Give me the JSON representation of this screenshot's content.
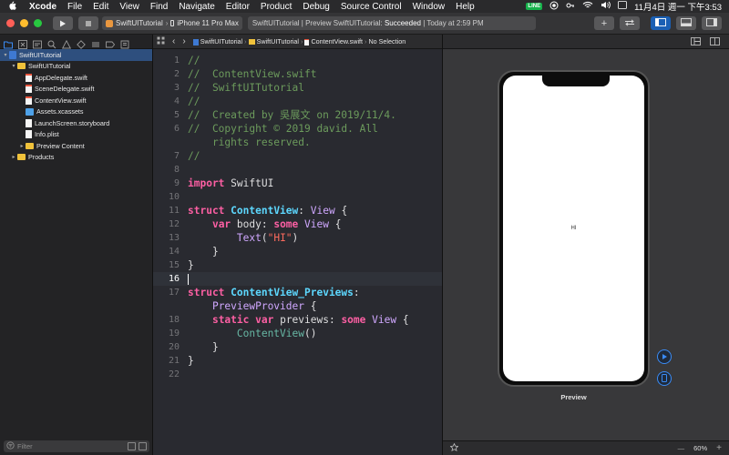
{
  "menubar": {
    "app": "Xcode",
    "items": [
      "File",
      "Edit",
      "View",
      "Find",
      "Navigate",
      "Editor",
      "Product",
      "Debug",
      "Source Control",
      "Window",
      "Help"
    ],
    "line_badge": "LINE",
    "datetime": "11月4日 週一 下午3:53"
  },
  "toolbar": {
    "scheme": "SwiftUITutorial",
    "device": "iPhone 11 Pro Max",
    "activity_prefix": "SwiftUITutorial | Preview SwiftUITutorial:",
    "activity_status": "Succeeded",
    "activity_time": "| Today at 2:59 PM"
  },
  "navigator": {
    "tree": [
      {
        "label": "SwiftUITutorial",
        "indent": 0,
        "icon": "project",
        "disclosure": "▾",
        "selected": true
      },
      {
        "label": "SwiftUITutorial",
        "indent": 1,
        "icon": "folder",
        "disclosure": "▾"
      },
      {
        "label": "AppDelegate.swift",
        "indent": 2,
        "icon": "swift"
      },
      {
        "label": "SceneDelegate.swift",
        "indent": 2,
        "icon": "swift"
      },
      {
        "label": "ContentView.swift",
        "indent": 2,
        "icon": "swift"
      },
      {
        "label": "Assets.xcassets",
        "indent": 2,
        "icon": "assets"
      },
      {
        "label": "LaunchScreen.storyboard",
        "indent": 2,
        "icon": "plain"
      },
      {
        "label": "Info.plist",
        "indent": 2,
        "icon": "plain"
      },
      {
        "label": "Preview Content",
        "indent": 2,
        "icon": "folder",
        "disclosure": "▸"
      },
      {
        "label": "Products",
        "indent": 1,
        "icon": "folder",
        "disclosure": "▸"
      }
    ],
    "filter_placeholder": "Filter"
  },
  "jumpbar": {
    "crumbs": [
      "SwiftUITutorial",
      "SwiftUITutorial",
      "ContentView.swift",
      "No Selection"
    ]
  },
  "editor": {
    "current_line": 16,
    "lines": [
      {
        "n": "1",
        "tokens": [
          [
            "comment",
            "//"
          ]
        ]
      },
      {
        "n": "2",
        "tokens": [
          [
            "comment",
            "//  ContentView.swift"
          ]
        ]
      },
      {
        "n": "3",
        "tokens": [
          [
            "comment",
            "//  SwiftUITutorial"
          ]
        ]
      },
      {
        "n": "4",
        "tokens": [
          [
            "comment",
            "//"
          ]
        ]
      },
      {
        "n": "5",
        "tokens": [
          [
            "comment",
            "//  Created by 吳展文 on 2019/11/4."
          ]
        ]
      },
      {
        "n": "6",
        "tokens": [
          [
            "comment",
            "//  Copyright © 2019 david. All"
          ]
        ]
      },
      {
        "n": "",
        "tokens": [
          [
            "comment",
            "    rights reserved."
          ]
        ]
      },
      {
        "n": "7",
        "tokens": [
          [
            "comment",
            "//"
          ]
        ]
      },
      {
        "n": "8",
        "tokens": []
      },
      {
        "n": "9",
        "tokens": [
          [
            "keyword",
            "import"
          ],
          [
            "plain",
            " SwiftUI"
          ]
        ]
      },
      {
        "n": "10",
        "tokens": []
      },
      {
        "n": "11",
        "tokens": [
          [
            "keyword",
            "struct"
          ],
          [
            "plain",
            " "
          ],
          [
            "type",
            "ContentView"
          ],
          [
            "plain",
            ": "
          ],
          [
            "sys",
            "View"
          ],
          [
            "plain",
            " {"
          ]
        ]
      },
      {
        "n": "12",
        "tokens": [
          [
            "plain",
            "    "
          ],
          [
            "keyword",
            "var"
          ],
          [
            "plain",
            " body: "
          ],
          [
            "keyword",
            "some"
          ],
          [
            "plain",
            " "
          ],
          [
            "sys",
            "View"
          ],
          [
            "plain",
            " {"
          ]
        ]
      },
      {
        "n": "13",
        "tokens": [
          [
            "plain",
            "        "
          ],
          [
            "sys",
            "Text"
          ],
          [
            "plain",
            "("
          ],
          [
            "str",
            "\"HI\""
          ],
          [
            "plain",
            ")"
          ]
        ]
      },
      {
        "n": "14",
        "tokens": [
          [
            "plain",
            "    }"
          ]
        ]
      },
      {
        "n": "15",
        "tokens": [
          [
            "plain",
            "}"
          ]
        ]
      },
      {
        "n": "16",
        "tokens": [
          [
            "cursor",
            ""
          ]
        ]
      },
      {
        "n": "17",
        "tokens": [
          [
            "keyword",
            "struct"
          ],
          [
            "plain",
            " "
          ],
          [
            "type",
            "ContentView_Previews"
          ],
          [
            "plain",
            ":"
          ]
        ]
      },
      {
        "n": "",
        "tokens": [
          [
            "plain",
            "    "
          ],
          [
            "sys",
            "PreviewProvider"
          ],
          [
            "plain",
            " {"
          ]
        ]
      },
      {
        "n": "18",
        "tokens": [
          [
            "plain",
            "    "
          ],
          [
            "keyword",
            "static"
          ],
          [
            "plain",
            " "
          ],
          [
            "keyword",
            "var"
          ],
          [
            "plain",
            " previews: "
          ],
          [
            "keyword",
            "some"
          ],
          [
            "plain",
            " "
          ],
          [
            "sys",
            "View"
          ],
          [
            "plain",
            " {"
          ]
        ]
      },
      {
        "n": "19",
        "tokens": [
          [
            "plain",
            "        "
          ],
          [
            "func",
            "ContentView"
          ],
          [
            "plain",
            "()"
          ]
        ]
      },
      {
        "n": "20",
        "tokens": [
          [
            "plain",
            "    }"
          ]
        ]
      },
      {
        "n": "21",
        "tokens": [
          [
            "plain",
            "}"
          ]
        ]
      },
      {
        "n": "22",
        "tokens": []
      }
    ]
  },
  "canvas": {
    "preview_text": "HI",
    "preview_label": "Preview",
    "zoom": "60%",
    "zoom_minus": "—",
    "zoom_plus": "+"
  },
  "colors": {
    "accent": "#3a8bf5",
    "comment": "#6c9b5c",
    "keyword": "#fc5fa3",
    "type": "#5dd8ff",
    "string": "#fc6a5d"
  }
}
